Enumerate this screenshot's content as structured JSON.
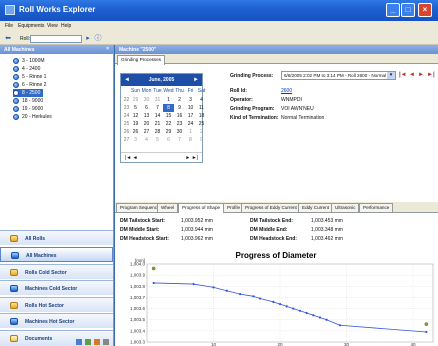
{
  "window": {
    "title": "Roll Works Explorer",
    "min": "_",
    "max": "□",
    "close": "×"
  },
  "menu": [
    "File",
    "Equipments",
    "View",
    "Help"
  ],
  "toolbar": {
    "roll_label": "Roll:",
    "roll_value": "",
    "back_icon": "back-icon",
    "go_icon": "go-icon",
    "info_icon": "info-icon"
  },
  "left": {
    "header": "All Machines",
    "close": "×",
    "machines": [
      "3 - 1000M",
      "4 - 2400",
      "5 - Rinne 1",
      "6 - Rinne 2",
      "8 - 2500",
      "18 - 9000",
      "19 - 9000",
      "20 - Herkules"
    ],
    "selected_index": 4,
    "nav": [
      "All Rolls",
      "All Machines",
      "Rolls Cold Sector",
      "Machines Cold Sector",
      "Rolls Hot Sector",
      "Machines Hot Sector",
      "Documents"
    ],
    "active_nav_index": 1
  },
  "right": {
    "header": "Machine \"2500\"",
    "top_tabs": [
      "Grinding Processes"
    ],
    "calendar": {
      "month": "June, 2005",
      "prev": "◄",
      "next": "►",
      "day_names": [
        "Sun",
        "Mon",
        "Tue",
        "Wed",
        "Thu",
        "Fri",
        "Sat"
      ],
      "weeks": [
        {
          "wk": "22",
          "days": [
            "29",
            "30",
            "31",
            "1",
            "2",
            "3",
            "4"
          ]
        },
        {
          "wk": "23",
          "days": [
            "5",
            "6",
            "7",
            "8",
            "9",
            "10",
            "11"
          ]
        },
        {
          "wk": "24",
          "days": [
            "12",
            "13",
            "14",
            "15",
            "16",
            "17",
            "18"
          ]
        },
        {
          "wk": "25",
          "days": [
            "19",
            "20",
            "21",
            "22",
            "23",
            "24",
            "25"
          ]
        },
        {
          "wk": "26",
          "days": [
            "26",
            "27",
            "28",
            "29",
            "30",
            "1",
            "2"
          ]
        },
        {
          "wk": "27",
          "days": [
            "3",
            "4",
            "5",
            "6",
            "7",
            "8",
            "9"
          ]
        }
      ],
      "selected_day": "8",
      "foot_left": "|◄ ◄",
      "foot_right": "► ►|"
    },
    "info": {
      "grinding_process_label": "Grinding Process:",
      "grinding_process_value": "6/8/2005 2:02 PM to 3:14 PM - Roll 2600 - Normal",
      "roll_id_label": "Roll Id:",
      "roll_id_value": "2600",
      "operator_label": "Operator:",
      "operator_value": "WNMPDI",
      "program_label": "Grinding Program:",
      "program_value": "VOI AWN'NEU",
      "termination_label": "Kind of Termination:",
      "termination_value": "Normal Termination"
    },
    "nav_arrows": [
      "|◄",
      "◄",
      "►",
      "►|"
    ],
    "sub_tabs": [
      "Program Sequence",
      "Wheel",
      "Progress of Shape",
      "Profile",
      "Progress of Eddy Current",
      "Eddy Current",
      "Ultrasonic",
      "Performance"
    ],
    "active_sub_tab": 2,
    "measurements": [
      {
        "label": "DM Tailstock Start:",
        "value": "1,003.952 mm"
      },
      {
        "label": "DM Middle Start:",
        "value": "1,003.944 mm"
      },
      {
        "label": "DM Headstock Start:",
        "value": "1,003.962 mm"
      },
      {
        "label": "DM Tailstock End:",
        "value": "1,003.453 mm"
      },
      {
        "label": "DM Middle End:",
        "value": "1,003.348 mm"
      },
      {
        "label": "DM Headstock End:",
        "value": "1,003.462 mm"
      }
    ]
  },
  "chart_data": {
    "type": "line",
    "title": "Progress of Diameter",
    "ylabel": "[mm]",
    "xlabel": "",
    "xlim": [
      0,
      43
    ],
    "ylim": [
      1003.3,
      1004.0
    ],
    "x_ticks": [
      10,
      20,
      30,
      40
    ],
    "y_ticks": [
      1003.3,
      1003.4,
      1003.5,
      1003.6,
      1003.7,
      1003.8,
      1003.9,
      1004.0
    ],
    "y_tick_labels": [
      "1,003.3",
      "1,003.4",
      "1,003.5",
      "1,003.6",
      "1,003.7",
      "1,003.8",
      "1,003.9",
      "1,004.0"
    ],
    "grid": true,
    "line_color": "#3355dd",
    "marker_color": "#8a9a3a",
    "series": [
      {
        "name": "",
        "x": [
          1,
          7,
          10,
          12,
          14,
          16,
          17,
          19,
          20,
          21,
          22,
          23,
          24,
          25,
          26,
          27,
          29,
          42
        ],
        "y": [
          1003.83,
          1003.82,
          1003.79,
          1003.76,
          1003.73,
          1003.71,
          1003.69,
          1003.66,
          1003.64,
          1003.62,
          1003.6,
          1003.58,
          1003.56,
          1003.54,
          1003.52,
          1003.5,
          1003.45,
          1003.39
        ]
      }
    ],
    "extra_points": [
      {
        "x": 1,
        "y": 1003.96
      },
      {
        "x": 42,
        "y": 1003.46
      }
    ]
  }
}
